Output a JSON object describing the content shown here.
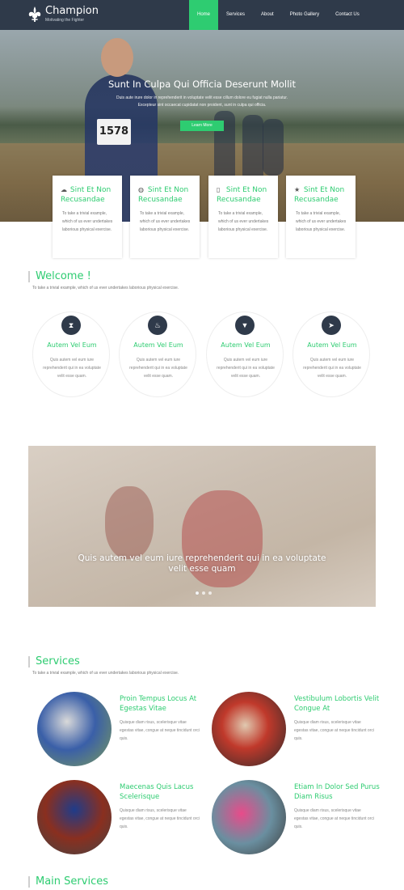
{
  "header": {
    "brand": "Champion",
    "tagline": "Motivating the Fighter",
    "nav": [
      "Home",
      "Services",
      "About",
      "Photo Gallery",
      "Contact Us"
    ],
    "active_index": 0,
    "nav_active_color": "#2ecc71",
    "bar_color": "#2f3a4a"
  },
  "hero": {
    "title": "Sunt In Culpa Qui Officia Deserunt Mollit",
    "text_line1": "Duis aute irure dolor in reprehenderit in voluptate velit esse cillum dolore eu fugiat nulla pariatur.",
    "text_line2": "Excepteur sint occaecat cupidatat non proident, sunt in culpa qui officia.",
    "button": "Learn More",
    "bib_number": "1578"
  },
  "cards": [
    {
      "icon": "cloud-icon",
      "glyph": "☁",
      "title": "Sint Et Non Recusandae",
      "text": "To take a trivial example, which of us ever undertakes laborious physical exercise."
    },
    {
      "icon": "globe-icon",
      "glyph": "◍",
      "title": "Sint Et Non Recusandae",
      "text": "To take a trivial example, which of us ever undertakes laborious physical exercise."
    },
    {
      "icon": "mobile-icon",
      "glyph": "▯",
      "title": "Sint Et Non Recusandae",
      "text": "To take a trivial example, which of us ever undertakes laborious physical exercise."
    },
    {
      "icon": "star-icon",
      "glyph": "★",
      "title": "Sint Et Non Recusandae",
      "text": "To take a trivial example, which of us ever undertakes laborious physical exercise."
    }
  ],
  "welcome": {
    "title": "Welcome !",
    "subtitle": "To take a trivial example, which of us ever undertakes laborious physical exercise."
  },
  "features": [
    {
      "icon": "hourglass-icon",
      "glyph": "⧗",
      "title": "Autem Vel Eum",
      "text": "Quis autem vel eum iure reprehenderit qui in ea voluptate velit esse quam."
    },
    {
      "icon": "fire-icon",
      "glyph": "♨",
      "title": "Autem Vel Eum",
      "text": "Quis autem vel eum iure reprehenderit qui in ea voluptate velit esse quam."
    },
    {
      "icon": "filter-icon",
      "glyph": "▼",
      "title": "Autem Vel Eum",
      "text": "Quis autem vel eum iure reprehenderit qui in ea voluptate velit esse quam."
    },
    {
      "icon": "send-icon",
      "glyph": "➤",
      "title": "Autem Vel Eum",
      "text": "Quis autem vel eum iure reprehenderit qui in ea voluptate velit esse quam."
    }
  ],
  "slider": {
    "caption": "Quis autem vel eum iure reprehenderit qui in ea voluptate velit esse quam",
    "slides": 3,
    "active": 0
  },
  "services": {
    "title": "Services",
    "subtitle": "To take a trivial example, which of us ever undertakes laborious physical exercise.",
    "items": [
      {
        "title": "Proin Tempus Locus At Egestas Vitae",
        "text": "Quisque diam risus, scelerisque vitae egestas vitae, congue at neque tincidunt orci quis.",
        "colors": [
          "#3a5fa8",
          "#d9d9d9",
          "#7a9c5a"
        ]
      },
      {
        "title": "Vestibulum Lobortis Velit Congue At",
        "text": "Quisque diam risus, scelerisque vitae egestas vitae, congue at neque tincidunt orci quis.",
        "colors": [
          "#c0392b",
          "#2b2b2b",
          "#e0c9b0"
        ]
      },
      {
        "title": "Maecenas Quis Lacus Scelerisque",
        "text": "Quisque diam risus, scelerisque vitae egestas vitae, congue at neque tincidunt orci quis.",
        "colors": [
          "#1f3c8a",
          "#8a2f1f",
          "#444444"
        ]
      },
      {
        "title": "Etiam In Dolor Sed Purus Diam Risus",
        "text": "Quisque diam risus, scelerisque vitae egestas vitae, congue at neque tincidunt orci quis.",
        "colors": [
          "#e84b8a",
          "#6a8fa0",
          "#3c3c3c"
        ]
      }
    ]
  },
  "main_services": {
    "title": "Main Services"
  }
}
